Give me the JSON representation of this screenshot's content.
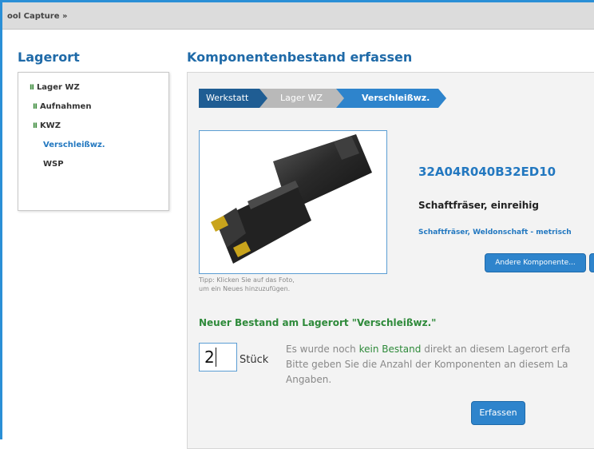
{
  "topbar": {
    "breadcrumb": "ool Capture »"
  },
  "sidebar": {
    "title": "Lagerort",
    "items": [
      {
        "label": "Lager WZ",
        "marker": "Ⅱ"
      },
      {
        "label": "Aufnahmen",
        "marker": "Ⅱ"
      },
      {
        "label": "KWZ",
        "marker": "Ⅱ"
      },
      {
        "label": "Verschleißwz.",
        "marker": ""
      },
      {
        "label": "WSP",
        "marker": ""
      }
    ]
  },
  "main": {
    "title": "Komponentenbestand erfassen",
    "steps": [
      {
        "label": "Werkstatt",
        "color": "#1f5d93"
      },
      {
        "label": "Lager WZ",
        "color": "#b9b9b9"
      },
      {
        "label": "Verschleißwz.",
        "color": "#2e84cc"
      }
    ],
    "photo_tip_line1": "Tipp: Klicken Sie auf das Foto,",
    "photo_tip_line2": "um ein Neues hinzuzufügen.",
    "part_number": "32A04R040B32ED10",
    "part_name": "Schaftfräser, einreihig",
    "part_category": "Schaftfräser, Weldonschaft - metrisch",
    "other_component_button": "Andere Komponente...",
    "new_stock_title": "Neuer Bestand am Lagerort \"Verschleißwz.\"",
    "quantity_value": "2",
    "quantity_unit": "Stück",
    "info_line1_before": "Es wurde noch ",
    "info_line1_highlight": "kein Bestand",
    "info_line1_after": " direkt an diesem Lagerort erfa",
    "info_line2": "Bitte geben Sie die Anzahl der Komponenten an diesem La",
    "info_line3": "Angaben.",
    "submit_button": "Erfassen"
  },
  "colors": {
    "accent": "#2378c0",
    "green": "#2e8a3a",
    "frame": "#2a8fd6"
  }
}
